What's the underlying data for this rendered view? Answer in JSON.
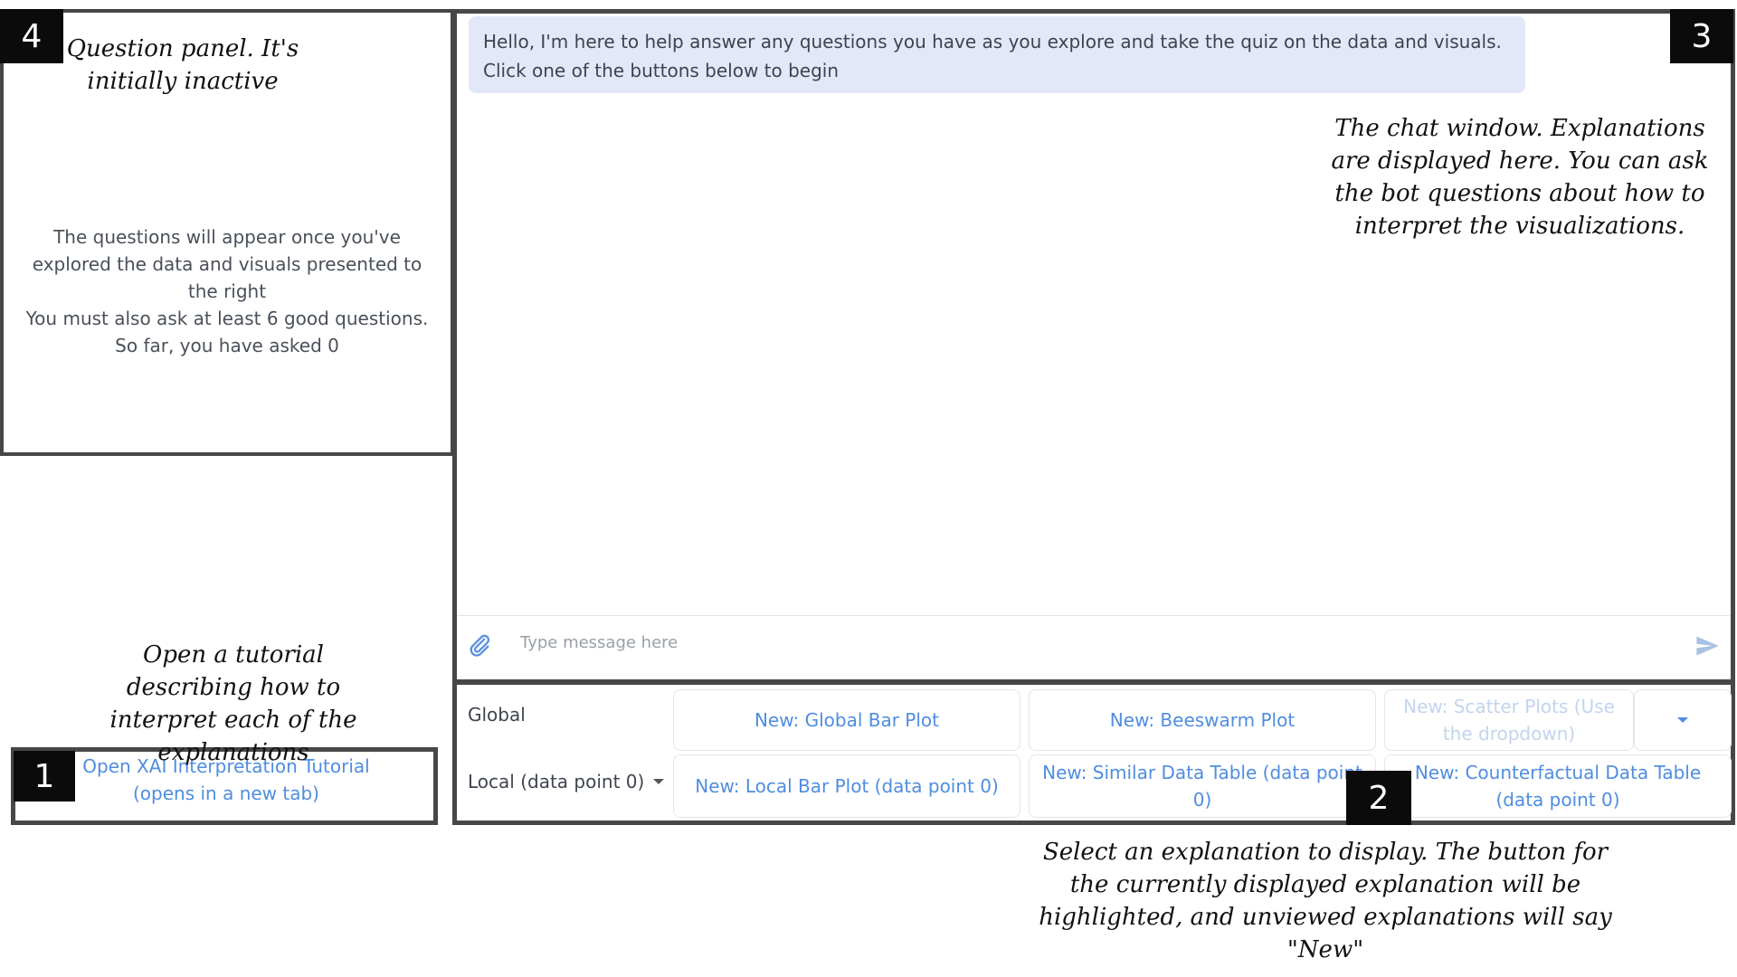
{
  "question_panel": {
    "line1": "The questions will appear once you've explored the data and visuals presented to the right",
    "line2": "You must also ask at least 6 good questions. So far, you have asked 0"
  },
  "chat": {
    "greeting": "Hello, I'm here to help answer any questions you have as you explore and take the quiz on the data and visuals. Click one of the buttons below to begin",
    "input_placeholder": "Type message here"
  },
  "selector": {
    "global_label": "Global",
    "local_label": "Local (data point 0)",
    "global_buttons": [
      "New: Global Bar Plot",
      "New: Beeswarm Plot",
      "New: Scatter Plots (Use the dropdown)"
    ],
    "local_buttons": [
      "New: Local Bar Plot (data point 0)",
      "New: Similar Data Table (data point 0)",
      "New: Counterfactual Data Table (data point 0)"
    ]
  },
  "tutorial": {
    "link": "Open XAI Interpretation Tutorial (opens in a new tab)"
  },
  "badges": {
    "b1": "1",
    "b2": "2",
    "b3": "3",
    "b4": "4"
  },
  "annotations": {
    "question_panel": "Question panel. It's initially inactive",
    "tutorial": "Open a tutorial describing how to interpret each of the explanations",
    "chat_window": "The chat window. Explanations are displayed here. You can ask the bot questions about how to interpret the visualizations.",
    "selector": "Select an explanation to display. The button for the currently displayed explanation will be highlighted, and unviewed explanations will say \"New\""
  },
  "colors": {
    "accent": "#4f8de0",
    "bubble": "#e3e8f8",
    "frame": "#474747"
  }
}
